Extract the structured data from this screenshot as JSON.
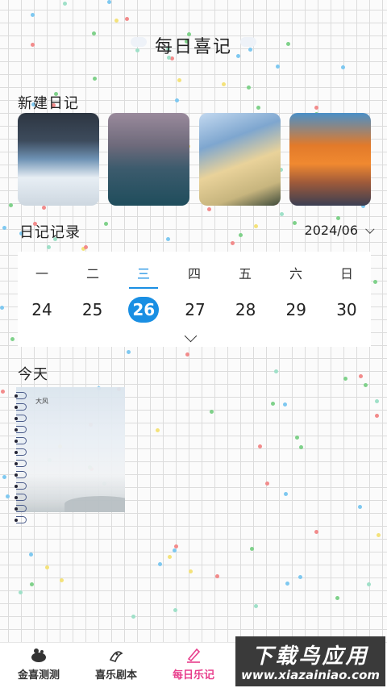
{
  "header": {
    "title": "每日喜记"
  },
  "new_diary": {
    "label": "新建日记",
    "templates": [
      {
        "name": "dark-clouds"
      },
      {
        "name": "rainy-sea"
      },
      {
        "name": "rainbow-sky"
      },
      {
        "name": "orange-sunset"
      }
    ]
  },
  "records": {
    "label": "日记记录",
    "month": "2024/06",
    "weekdays": [
      "一",
      "二",
      "三",
      "四",
      "五",
      "六",
      "日"
    ],
    "dates": [
      "24",
      "25",
      "26",
      "27",
      "28",
      "29",
      "30"
    ],
    "selected_index": 2,
    "accent": "#1a8fe3"
  },
  "today": {
    "label": "今天",
    "entry_text": "大风"
  },
  "tabbar": {
    "items": [
      {
        "label": "金喜测测",
        "icon": "pot-icon"
      },
      {
        "label": "喜乐剧本",
        "icon": "script-icon"
      },
      {
        "label": "每日乐记",
        "icon": "pen-icon",
        "active": true
      },
      {
        "label": "",
        "icon": ""
      },
      {
        "label": "",
        "icon": ""
      }
    ],
    "active_color": "#e83e8c"
  },
  "watermark": {
    "line1": "下载鸟应用",
    "line2": "www.xiazainiao.com"
  }
}
